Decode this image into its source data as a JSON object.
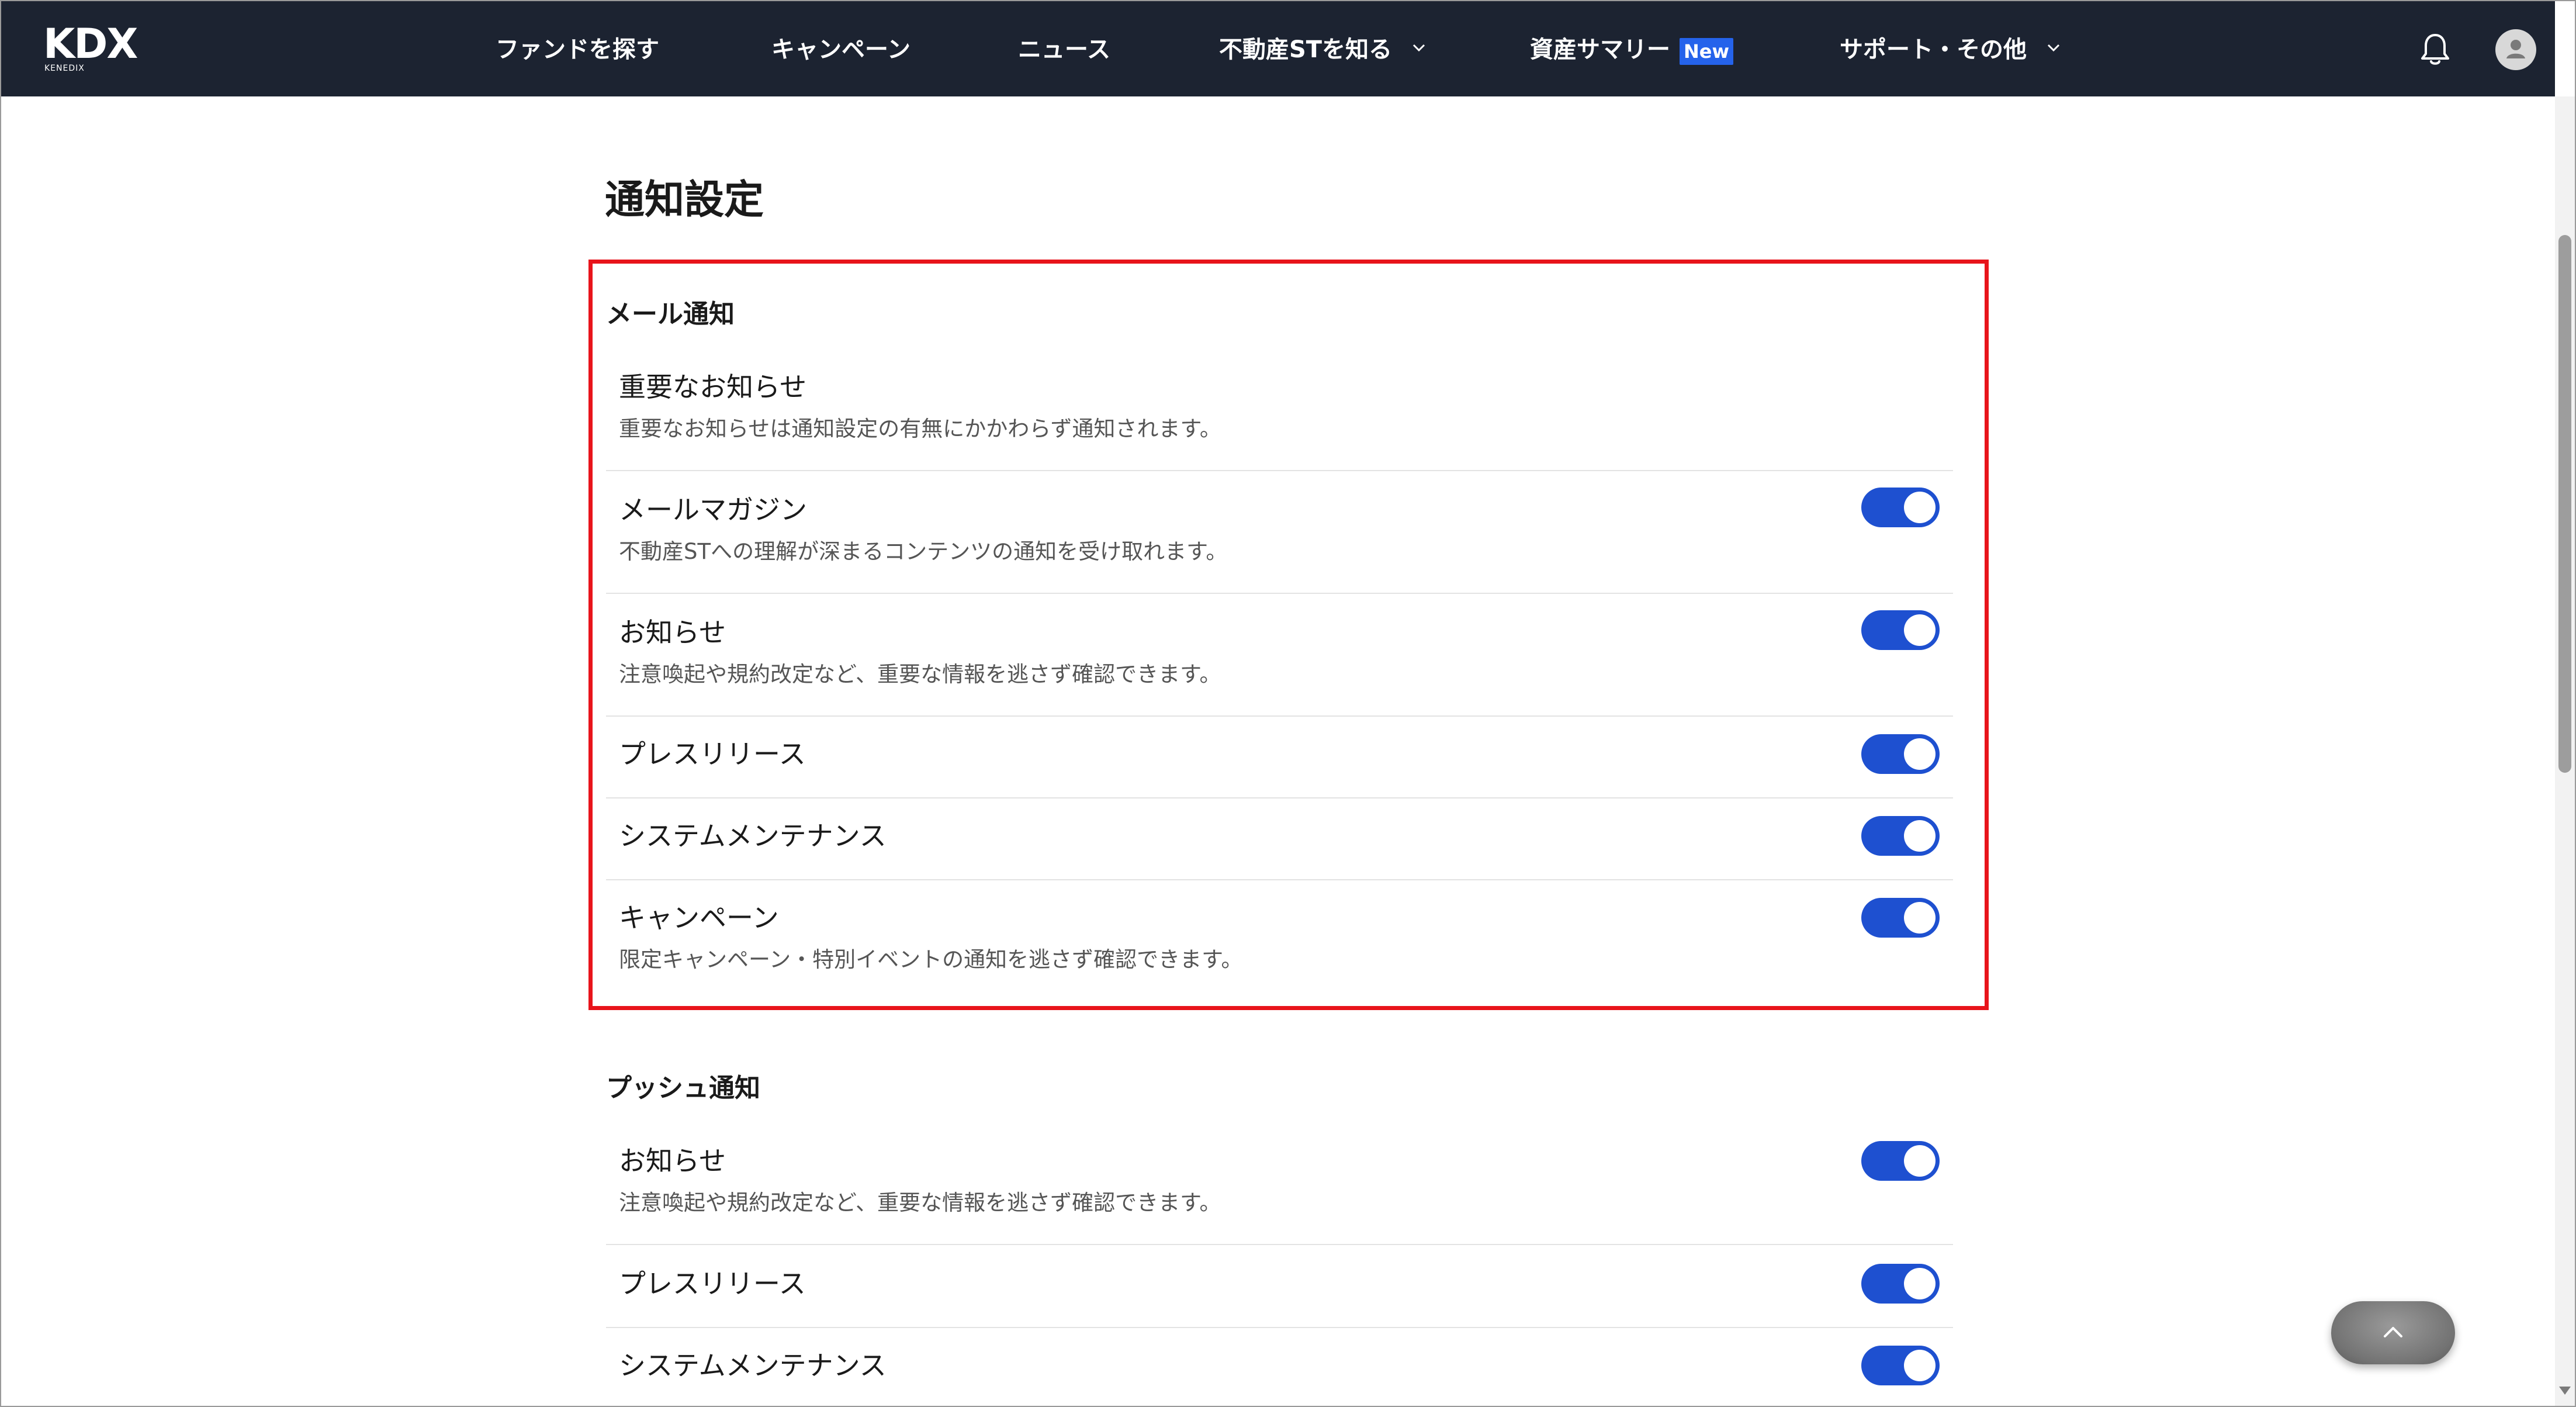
{
  "header": {
    "logo": {
      "main": "KDX",
      "sub": "KENEDIX"
    },
    "nav": [
      {
        "id": "find-fund",
        "label": "ファンドを探す",
        "dropdown": false
      },
      {
        "id": "campaign",
        "label": "キャンペーン",
        "dropdown": false
      },
      {
        "id": "news",
        "label": "ニュース",
        "dropdown": false
      },
      {
        "id": "learn-st",
        "label": "不動産STを知る",
        "dropdown": true
      },
      {
        "id": "asset-summary",
        "label": "資産サマリー",
        "dropdown": false,
        "badge": "New"
      },
      {
        "id": "support",
        "label": "サポート・その他",
        "dropdown": true
      }
    ],
    "icons": {
      "bell": "bell-icon",
      "avatar": "user-avatar-icon"
    }
  },
  "page": {
    "title": "通知設定"
  },
  "email_section": {
    "title": "メール通知",
    "items": [
      {
        "label": "重要なお知らせ",
        "description": "重要なお知らせは通知設定の有無にかかわらず通知されます。",
        "toggle": null
      },
      {
        "label": "メールマガジン",
        "description": "不動産STへの理解が深まるコンテンツの通知を受け取れます。",
        "toggle": true
      },
      {
        "label": "お知らせ",
        "description": "注意喚起や規約改定など、重要な情報を逃さず確認できます。",
        "toggle": true
      },
      {
        "label": "プレスリリース",
        "description": "",
        "toggle": true
      },
      {
        "label": "システムメンテナンス",
        "description": "",
        "toggle": true
      },
      {
        "label": "キャンペーン",
        "description": "限定キャンペーン・特別イベントの通知を逃さず確認できます。",
        "toggle": true
      }
    ]
  },
  "push_section": {
    "title": "プッシュ通知",
    "items": [
      {
        "label": "お知らせ",
        "description": "注意喚起や規約改定など、重要な情報を逃さず確認できます。",
        "toggle": true
      },
      {
        "label": "プレスリリース",
        "description": "",
        "toggle": true
      },
      {
        "label": "システムメンテナンス",
        "description": "",
        "toggle": true
      }
    ]
  },
  "colors": {
    "header_bg": "#1c2331",
    "toggle_on": "#1e50d0",
    "badge_bg": "#2563eb",
    "highlight_border": "#e8141b"
  },
  "icons": {
    "back_to_top": "chevron-up-icon"
  }
}
